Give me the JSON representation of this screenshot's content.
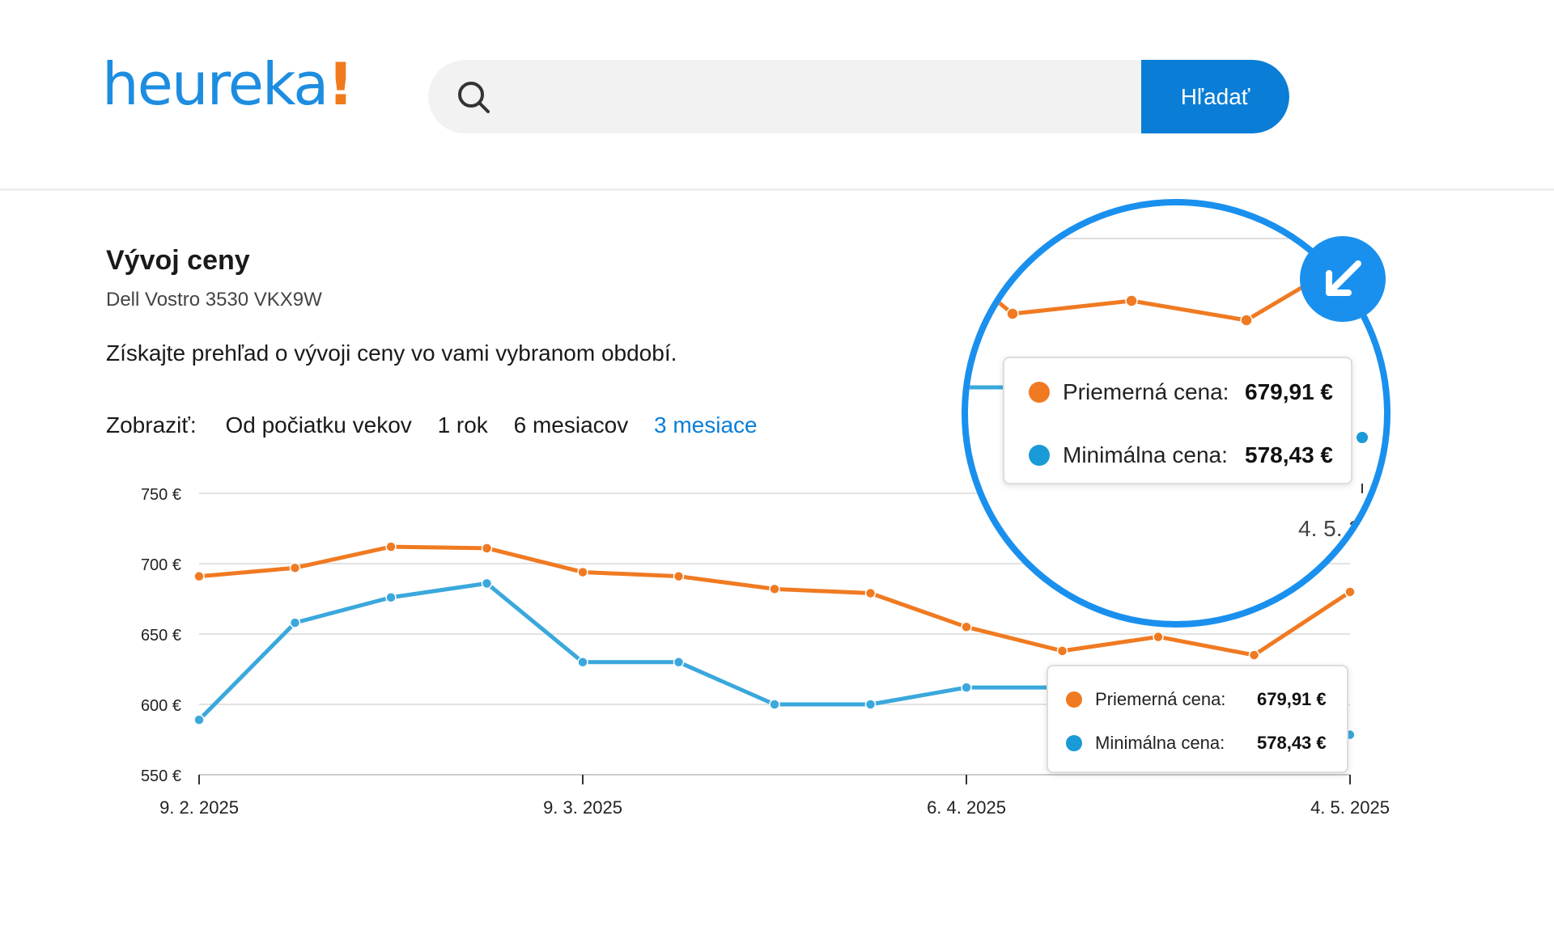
{
  "header": {
    "logo_text": "heureka",
    "logo_mark": "!",
    "search_placeholder": "",
    "search_button": "Hľadať",
    "search_icon": "search-icon"
  },
  "page": {
    "title": "Vývoj ceny",
    "product": "Dell Vostro 3530 VKX9W",
    "description": "Získajte prehľad o vývoji ceny vo vami vybranom období."
  },
  "period": {
    "label": "Zobraziť:",
    "options": [
      "Od počiatku vekov",
      "1 rok",
      "6 mesiacov",
      "3 mesiace"
    ],
    "selected": "3 mesiace"
  },
  "tooltip": {
    "avg_label": "Priemerná cena:",
    "avg_value": "679,91 €",
    "min_label": "Minimálna cena:",
    "min_value": "578,43 €"
  },
  "zoom": {
    "date_label": "4. 5. 2",
    "button_icon": "arrow-down-left-icon"
  },
  "colors": {
    "brand_blue": "#1d8de0",
    "brand_orange": "#f17a1b",
    "avg_series": "#f07a22",
    "min_series": "#3aa8dc",
    "accent": "#1a90ee"
  },
  "chart_data": {
    "type": "line",
    "x": [
      "9. 2. 2025",
      "16. 2. 2025",
      "23. 2. 2025",
      "2. 3. 2025",
      "9. 3. 2025",
      "16. 3. 2025",
      "23. 3. 2025",
      "30. 3. 2025",
      "6. 4. 2025",
      "13. 4. 2025",
      "20. 4. 2025",
      "27. 4. 2025",
      "4. 5. 2025"
    ],
    "x_ticks": [
      "9. 2. 2025",
      "9. 3. 2025",
      "6. 4. 2025",
      "4. 5. 2025"
    ],
    "y_ticks": [
      "750 €",
      "700 €",
      "650 €",
      "600 €",
      "550 €"
    ],
    "ylim": [
      550,
      750
    ],
    "series": [
      {
        "name": "Priemerná cena",
        "values": [
          691,
          697,
          712,
          711,
          694,
          691,
          682,
          679,
          655,
          638,
          648,
          635,
          679.91
        ]
      },
      {
        "name": "Minimálna cena",
        "values": [
          589,
          658,
          676,
          686,
          630,
          630,
          600,
          600,
          612,
          612,
          612,
          612,
          578.43
        ]
      }
    ],
    "grid": true,
    "legend": "tooltip"
  }
}
